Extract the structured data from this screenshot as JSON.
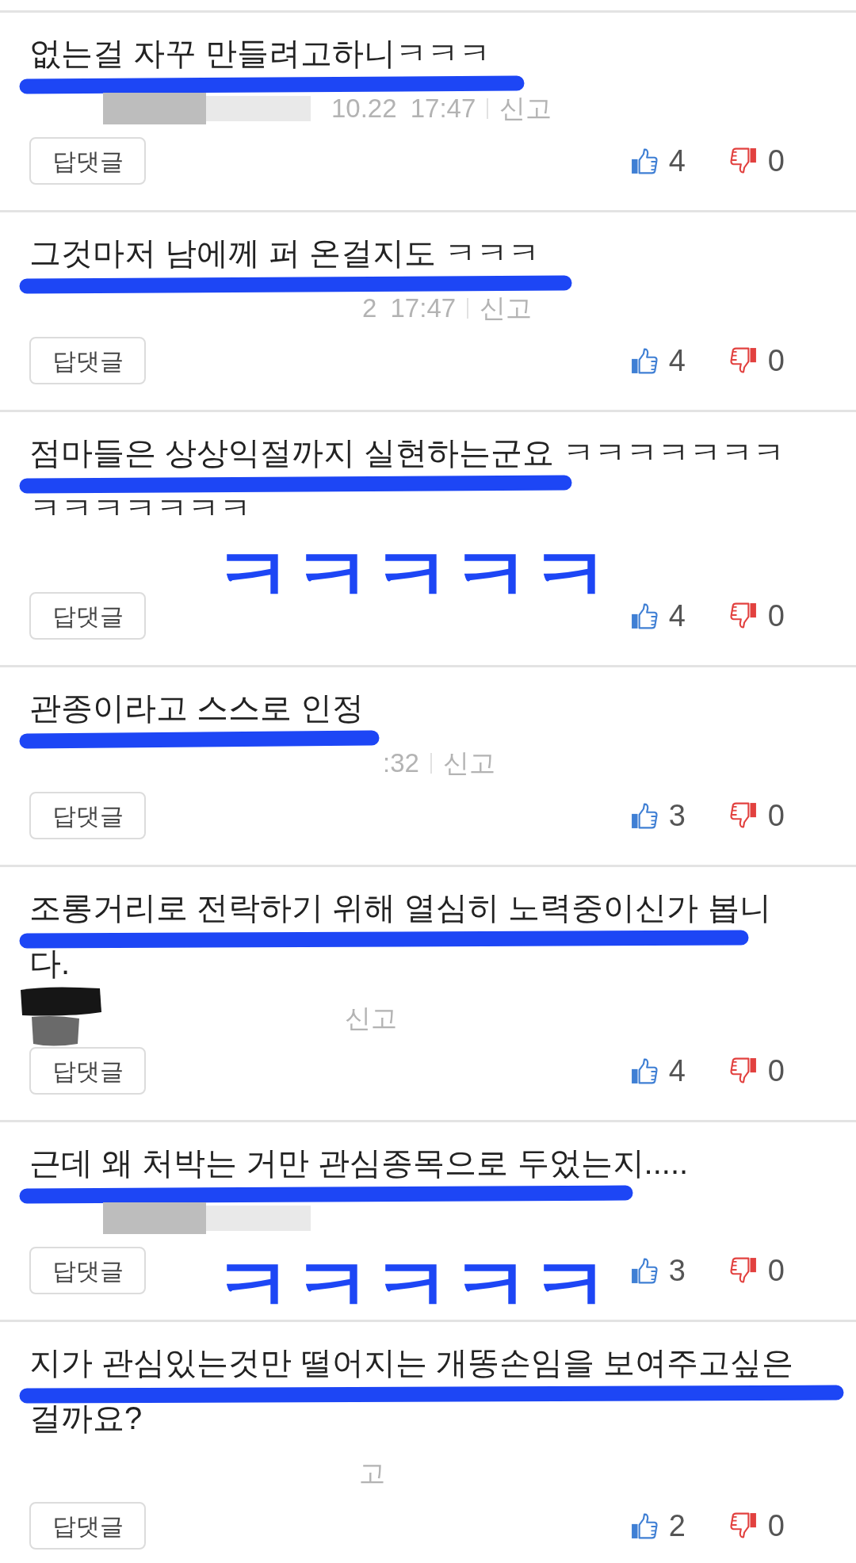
{
  "comments": [
    {
      "text": "없는걸 자꾸 만들려고하니ㅋㅋㅋ",
      "underlined": true,
      "redaction": {
        "kind": "blocks"
      },
      "meta": {
        "time": "10.22 17:47",
        "report": "신고"
      },
      "reply_button": "답댓글",
      "likes": "4",
      "dislikes": "0"
    },
    {
      "text": "그것마저 남에께 퍼 온걸지도 ㅋㅋㅋ",
      "underlined": true,
      "meta": {
        "time": "2 17:47",
        "report": "신고"
      },
      "reply_button": "답댓글",
      "likes": "4",
      "dislikes": "0"
    },
    {
      "text": "점마들은 상상익절까지 실현하는군요 ㅋㅋㅋㅋㅋㅋㅋㅋㅋㅋㅋㅋㅋㅋ",
      "underlined": true,
      "handwriting": "ㅋㅋㅋㅋㅋ",
      "reply_button": "답댓글",
      "likes": "4",
      "dislikes": "0"
    },
    {
      "text": "관종이라고 스스로 인정",
      "underlined": true,
      "meta": {
        "time": ":32",
        "report": "신고"
      },
      "reply_button": "답댓글",
      "likes": "3",
      "dislikes": "0"
    },
    {
      "text": "조롱거리로 전락하기 위해 열심히 노력중이신가 봅니다.",
      "underlined": true,
      "redaction": {
        "kind": "scribble"
      },
      "meta": {
        "report": "신고"
      },
      "reply_button": "답댓글",
      "likes": "4",
      "dislikes": "0"
    },
    {
      "text": "근데 왜 처박는 거만 관심종목으로 두었는지.....",
      "underlined": true,
      "redaction": {
        "kind": "blocks"
      },
      "handwriting": "ㅋㅋㅋㅋㅋ",
      "reply_button": "답댓글",
      "likes": "3",
      "dislikes": "0"
    },
    {
      "text": "지가 관심있는것만 떨어지는 개똥손임을 보여주고싶은 걸까요?",
      "underlined": true,
      "meta": {
        "report": "고"
      },
      "reply_button": "답댓글",
      "likes": "2",
      "dislikes": "0"
    }
  ]
}
